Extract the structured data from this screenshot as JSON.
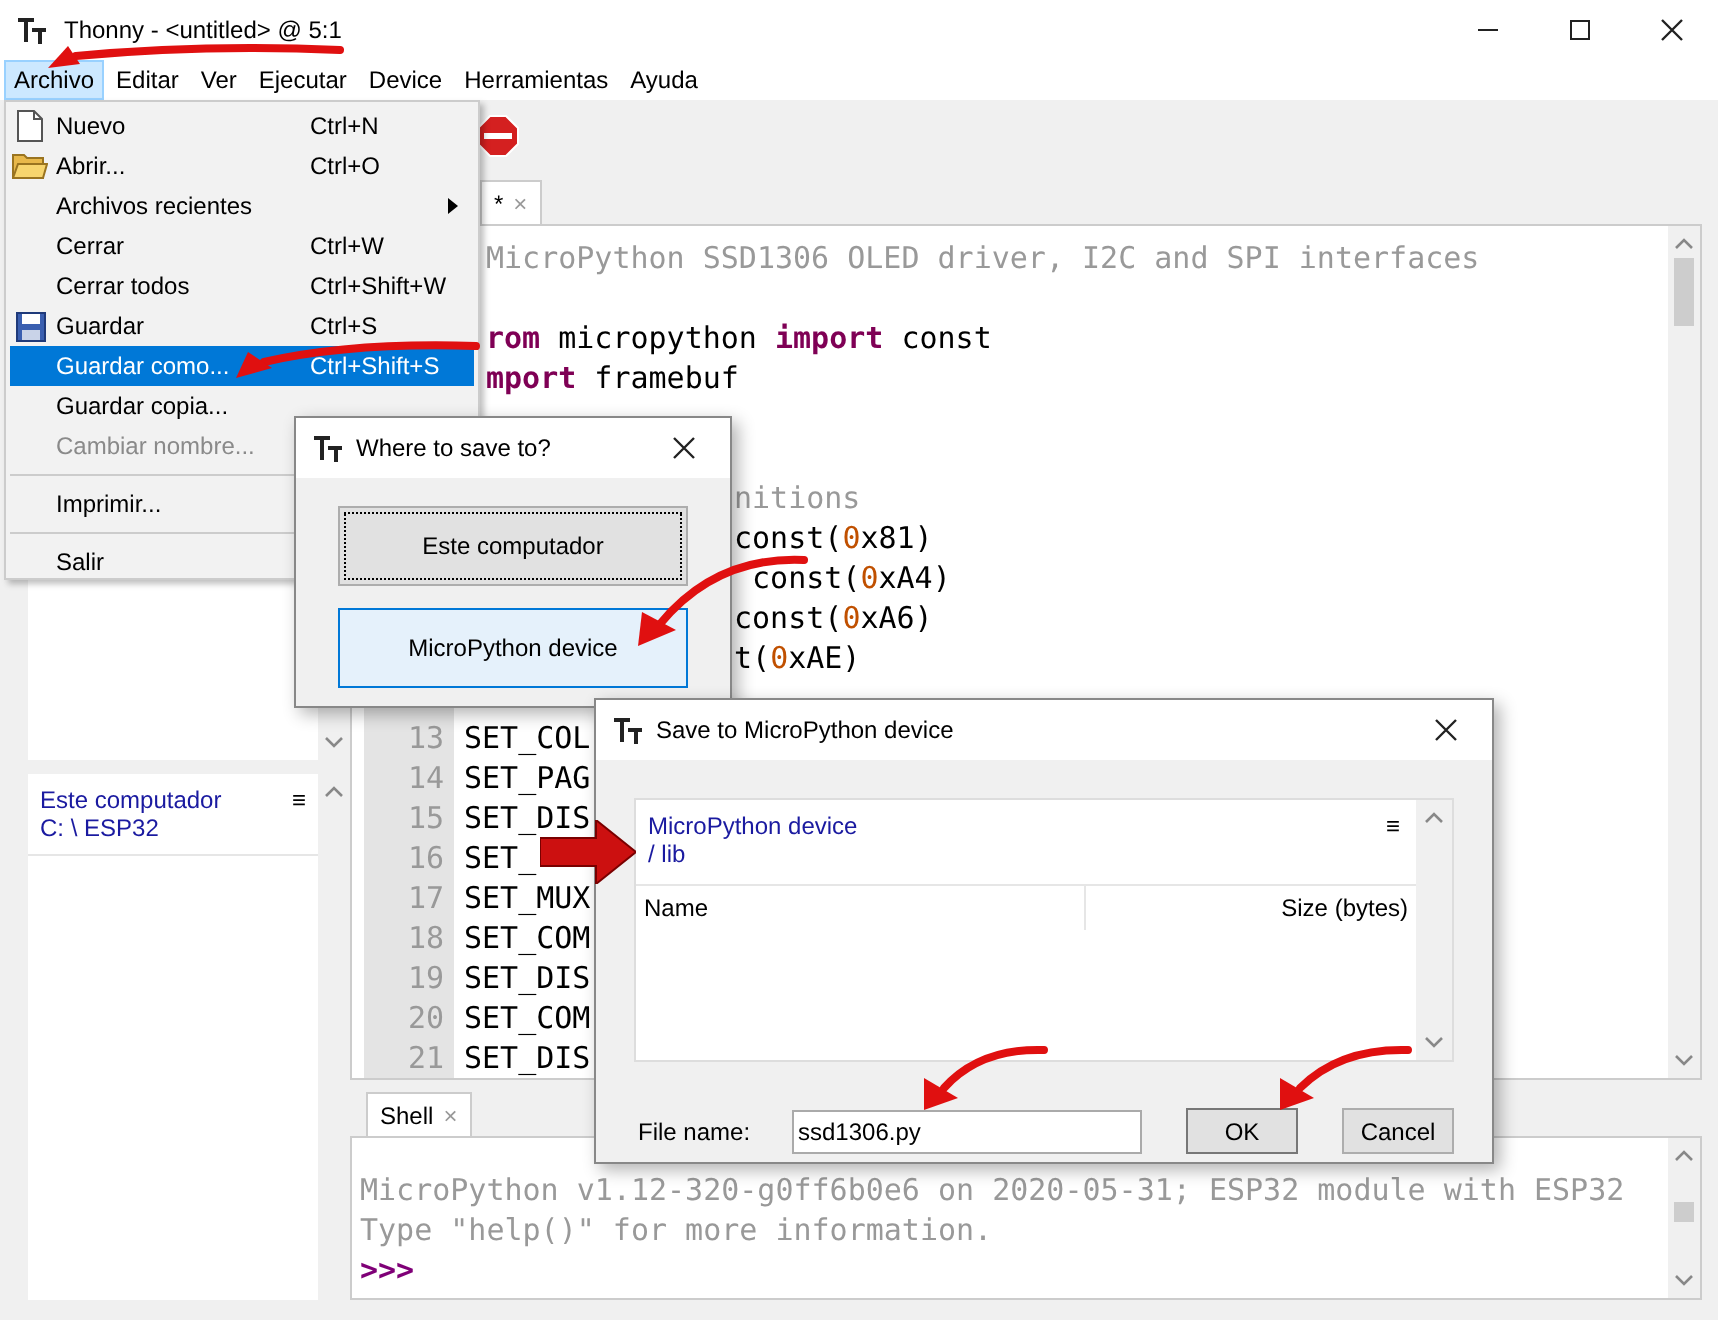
{
  "window": {
    "title": "Thonny - <untitled> @ 5:1"
  },
  "menu_bar": [
    {
      "label": "Archivo",
      "selected": true
    },
    {
      "label": "Editar",
      "selected": false
    },
    {
      "label": "Ver",
      "selected": false
    },
    {
      "label": "Ejecutar",
      "selected": false
    },
    {
      "label": "Device",
      "selected": false
    },
    {
      "label": "Herramientas",
      "selected": false
    },
    {
      "label": "Ayuda",
      "selected": false
    }
  ],
  "file_browser": {
    "title": "Este computador",
    "path": "C: \\ ESP32",
    "menu_icon": "≡"
  },
  "editor": {
    "tab": {
      "label": "*",
      "close": "×"
    },
    "lines": [
      {
        "kind": "after-menu",
        "segments": [
          {
            "kind": "comment",
            "text": "MicroPython SSD1306 OLED driver, I2C and SPI interfaces"
          }
        ]
      },
      {
        "kind": "blank"
      },
      {
        "kind": "after-menu",
        "segments": [
          {
            "kind": "keyword",
            "text": "rom"
          },
          {
            "kind": "plain",
            "text": " micropython "
          },
          {
            "kind": "keyword",
            "text": "import"
          },
          {
            "kind": "plain",
            "text": " const"
          }
        ]
      },
      {
        "kind": "after-menu",
        "segments": [
          {
            "kind": "keyword",
            "text": "mport"
          },
          {
            "kind": "plain",
            "text": " framebuf"
          }
        ]
      },
      {
        "kind": "blank"
      },
      {
        "kind": "blank"
      },
      {
        "kind": "after-dialog",
        "segments": [
          {
            "kind": "comment",
            "text": "nitions"
          }
        ]
      },
      {
        "kind": "after-dialog",
        "segments": [
          {
            "kind": "plain",
            "text": "const("
          },
          {
            "kind": "number",
            "text": "0"
          },
          {
            "kind": "plain",
            "text": "x81)"
          }
        ]
      },
      {
        "kind": "after-dialog",
        "segments": [
          {
            "kind": "plain",
            "text": " const("
          },
          {
            "kind": "number",
            "text": "0"
          },
          {
            "kind": "plain",
            "text": "xA4)"
          }
        ]
      },
      {
        "kind": "after-dialog",
        "segments": [
          {
            "kind": "plain",
            "text": "const("
          },
          {
            "kind": "number",
            "text": "0"
          },
          {
            "kind": "plain",
            "text": "xA6)"
          }
        ]
      },
      {
        "kind": "after-dialog",
        "segments": [
          {
            "kind": "plain",
            "text": "t("
          },
          {
            "kind": "number",
            "text": "0"
          },
          {
            "kind": "plain",
            "text": "xAE)"
          }
        ]
      },
      {
        "kind": "blank"
      },
      {
        "kind": "full",
        "number": "13",
        "segments": [
          {
            "kind": "plain",
            "text": "SET_COL"
          }
        ]
      },
      {
        "kind": "full",
        "number": "14",
        "segments": [
          {
            "kind": "plain",
            "text": "SET_PAG"
          }
        ]
      },
      {
        "kind": "full",
        "number": "15",
        "segments": [
          {
            "kind": "plain",
            "text": "SET_DIS"
          }
        ]
      },
      {
        "kind": "full",
        "number": "16",
        "segments": [
          {
            "kind": "plain",
            "text": "SET_"
          }
        ]
      },
      {
        "kind": "full",
        "number": "17",
        "segments": [
          {
            "kind": "plain",
            "text": "SET_MUX"
          }
        ]
      },
      {
        "kind": "full",
        "number": "18",
        "segments": [
          {
            "kind": "plain",
            "text": "SET_COM"
          }
        ]
      },
      {
        "kind": "full",
        "number": "19",
        "segments": [
          {
            "kind": "plain",
            "text": "SET_DIS"
          }
        ]
      },
      {
        "kind": "full",
        "number": "20",
        "segments": [
          {
            "kind": "plain",
            "text": "SET_COM"
          }
        ]
      },
      {
        "kind": "full",
        "number": "21",
        "segments": [
          {
            "kind": "plain",
            "text": "SET_DIS"
          }
        ]
      }
    ]
  },
  "shell": {
    "tab": {
      "label": "Shell",
      "close": "×"
    },
    "lines": [
      {
        "kind": "output",
        "text": "MicroPython v1.12-320-g0ff6b0e6 on 2020-05-31; ESP32 module with ESP32"
      },
      {
        "kind": "output",
        "text": "Type \"help()\" for more information."
      },
      {
        "kind": "prompt",
        "text": ">>>"
      }
    ]
  },
  "file_menu": {
    "items": [
      {
        "kind": "document-item",
        "label": "Nuevo",
        "shortcut": "Ctrl+N",
        "submenu": false,
        "disabled": false,
        "selected": false
      },
      {
        "kind": "folder-item",
        "label": "Abrir...",
        "shortcut": "Ctrl+O",
        "submenu": false,
        "disabled": false,
        "selected": false
      },
      {
        "kind": "item",
        "label": "Archivos recientes",
        "submenu": true,
        "disabled": false,
        "selected": false
      },
      {
        "kind": "item",
        "label": "Cerrar",
        "shortcut": "Ctrl+W",
        "submenu": false,
        "disabled": false,
        "selected": false
      },
      {
        "kind": "item",
        "label": "Cerrar todos",
        "shortcut": "Ctrl+Shift+W",
        "submenu": false,
        "disabled": false,
        "selected": false
      },
      {
        "kind": "floppy-item",
        "label": "Guardar",
        "shortcut": "Ctrl+S",
        "submenu": false,
        "disabled": false,
        "selected": false
      },
      {
        "kind": "item",
        "label": "Guardar como...",
        "shortcut": "Ctrl+Shift+S",
        "submenu": false,
        "disabled": false,
        "selected": true
      },
      {
        "kind": "item",
        "label": "Guardar copia...",
        "submenu": false,
        "disabled": false,
        "selected": false
      },
      {
        "kind": "item",
        "label": "Cambiar nombre...",
        "submenu": false,
        "disabled": true,
        "selected": false
      },
      {
        "kind": "separator"
      },
      {
        "kind": "item",
        "label": "Imprimir...",
        "submenu": false,
        "disabled": false,
        "selected": false
      },
      {
        "kind": "separator"
      },
      {
        "kind": "item",
        "label": "Salir",
        "submenu": false,
        "disabled": false,
        "selected": false
      }
    ]
  },
  "where_dialog": {
    "title": "Where to save to?",
    "buttons": [
      {
        "label": "Este computador",
        "focused": true,
        "hovered": false
      },
      {
        "label": "MicroPython device",
        "focused": false,
        "hovered": true
      }
    ]
  },
  "save_dialog": {
    "title": "Save to MicroPython device",
    "location": {
      "device": "MicroPython device",
      "path": "/ lib",
      "menu_icon": "≡"
    },
    "columns": [
      "Name",
      "Size (bytes)"
    ],
    "file_name_label": "File name:",
    "file_name": "ssd1306.py",
    "buttons": [
      {
        "label": "OK",
        "default": true
      },
      {
        "label": "Cancel",
        "default": false
      }
    ]
  }
}
